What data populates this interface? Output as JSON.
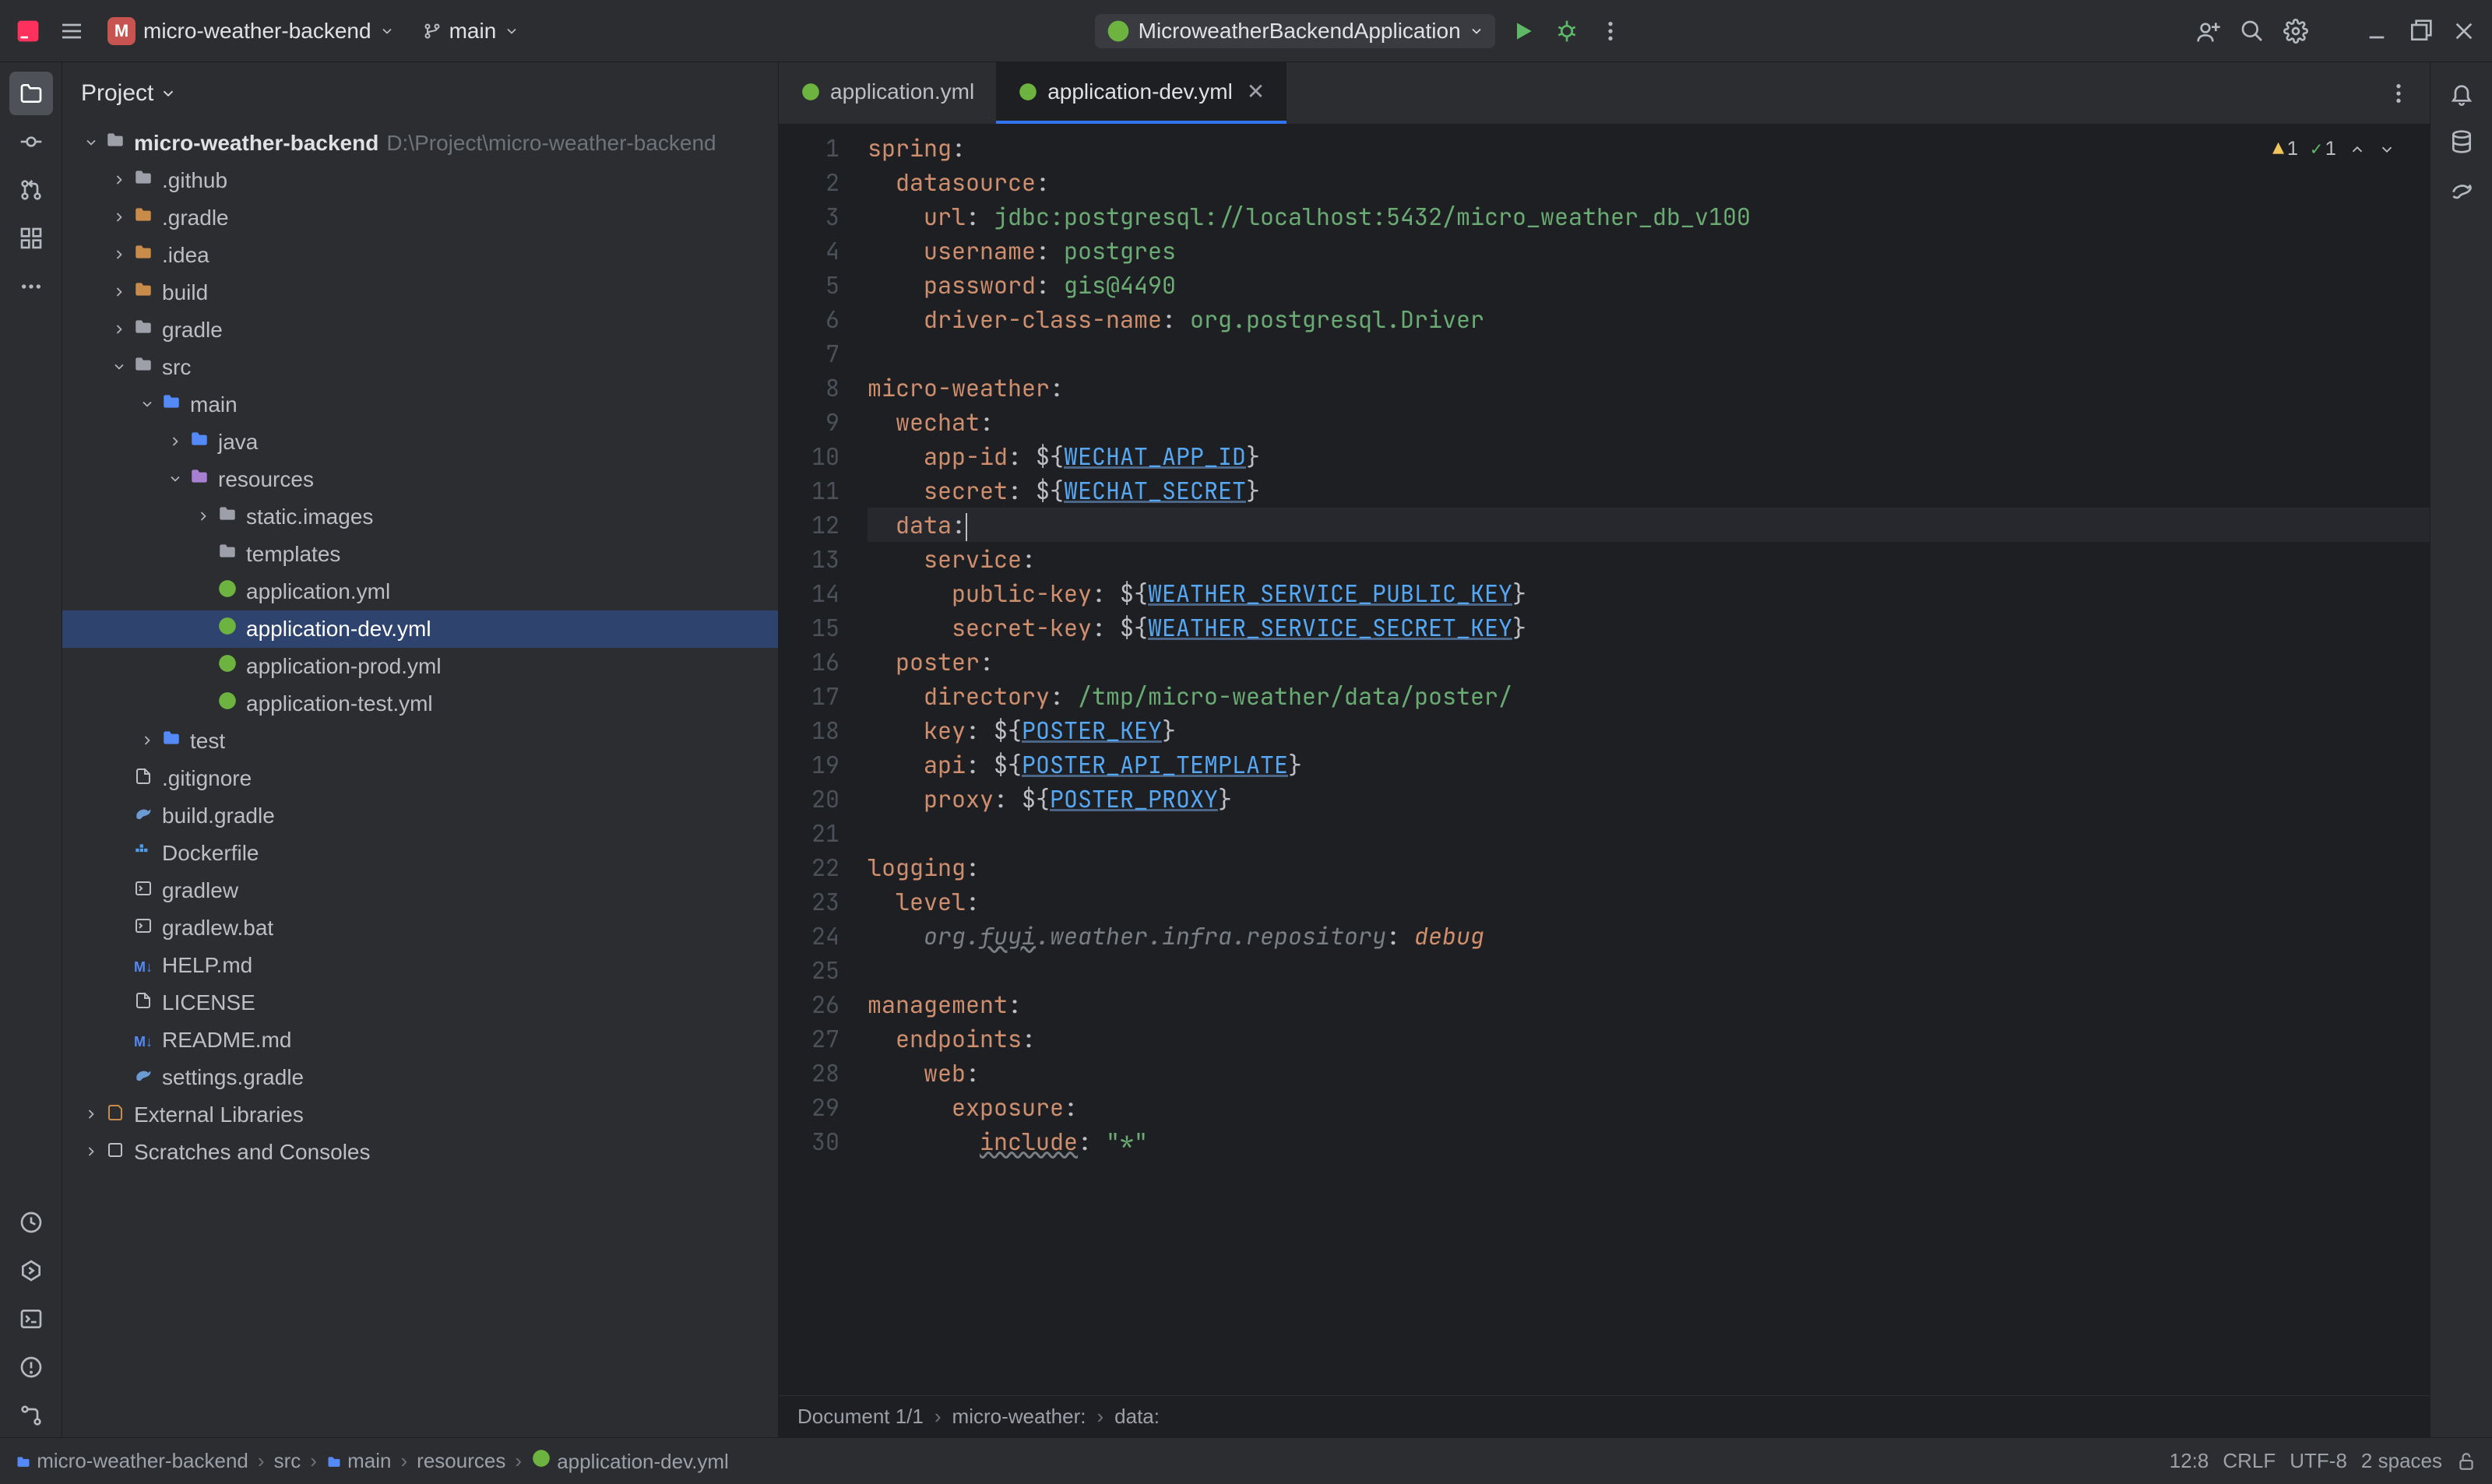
{
  "navbar": {
    "projectInitial": "M",
    "projectName": "micro-weather-backend",
    "branch": "main",
    "runConfig": "MicroweatherBackendApplication"
  },
  "projectPane": {
    "title": "Project",
    "rootName": "micro-weather-backend",
    "rootPath": "D:\\Project\\micro-weather-backend",
    "items": [
      {
        "depth": 1,
        "chev": "closed",
        "icon": "folder",
        "label": ".github"
      },
      {
        "depth": 1,
        "chev": "closed",
        "icon": "folder-orange",
        "label": ".gradle"
      },
      {
        "depth": 1,
        "chev": "closed",
        "icon": "folder-orange",
        "label": ".idea"
      },
      {
        "depth": 1,
        "chev": "closed",
        "icon": "folder-orange",
        "label": "build"
      },
      {
        "depth": 1,
        "chev": "closed",
        "icon": "folder",
        "label": "gradle"
      },
      {
        "depth": 1,
        "chev": "open",
        "icon": "folder",
        "label": "src"
      },
      {
        "depth": 2,
        "chev": "open",
        "icon": "folder-blue",
        "label": "main"
      },
      {
        "depth": 3,
        "chev": "closed",
        "icon": "folder-blue",
        "label": "java"
      },
      {
        "depth": 3,
        "chev": "open",
        "icon": "folder-res",
        "label": "resources"
      },
      {
        "depth": 4,
        "chev": "closed",
        "icon": "folder",
        "label": "static.images"
      },
      {
        "depth": 4,
        "chev": "none",
        "icon": "folder",
        "label": "templates"
      },
      {
        "depth": 4,
        "chev": "none",
        "icon": "spring",
        "label": "application.yml"
      },
      {
        "depth": 4,
        "chev": "none",
        "icon": "spring",
        "label": "application-dev.yml",
        "selected": true
      },
      {
        "depth": 4,
        "chev": "none",
        "icon": "spring",
        "label": "application-prod.yml"
      },
      {
        "depth": 4,
        "chev": "none",
        "icon": "spring",
        "label": "application-test.yml"
      },
      {
        "depth": 2,
        "chev": "closed",
        "icon": "folder-blue",
        "label": "test"
      },
      {
        "depth": 1,
        "chev": "none",
        "icon": "file",
        "label": ".gitignore"
      },
      {
        "depth": 1,
        "chev": "none",
        "icon": "gradle",
        "label": "build.gradle"
      },
      {
        "depth": 1,
        "chev": "none",
        "icon": "docker",
        "label": "Dockerfile"
      },
      {
        "depth": 1,
        "chev": "none",
        "icon": "sh",
        "label": "gradlew"
      },
      {
        "depth": 1,
        "chev": "none",
        "icon": "sh",
        "label": "gradlew.bat"
      },
      {
        "depth": 1,
        "chev": "none",
        "icon": "md",
        "label": "HELP.md",
        "class": "c-md"
      },
      {
        "depth": 1,
        "chev": "none",
        "icon": "file",
        "label": "LICENSE"
      },
      {
        "depth": 1,
        "chev": "none",
        "icon": "md",
        "label": "README.md"
      },
      {
        "depth": 1,
        "chev": "none",
        "icon": "gradle",
        "label": "settings.gradle"
      }
    ],
    "extLibs": "External Libraries",
    "scratches": "Scratches and Consoles"
  },
  "tabs": [
    {
      "label": "application.yml",
      "active": false
    },
    {
      "label": "application-dev.yml",
      "active": true
    }
  ],
  "inspections": {
    "warn": "1",
    "ok": "1"
  },
  "code": {
    "lines": [
      [
        [
          "k-key",
          "spring"
        ],
        [
          "k-plain",
          ":"
        ]
      ],
      [
        [
          "k-plain",
          "  "
        ],
        [
          "k-key",
          "datasource"
        ],
        [
          "k-plain",
          ":"
        ]
      ],
      [
        [
          "k-plain",
          "    "
        ],
        [
          "k-key",
          "url"
        ],
        [
          "k-plain",
          ": "
        ],
        [
          "k-str",
          "jdbc:postgresql://localhost:5432/micro_weather_db_v100"
        ]
      ],
      [
        [
          "k-plain",
          "    "
        ],
        [
          "k-key",
          "username"
        ],
        [
          "k-plain",
          ": "
        ],
        [
          "k-str",
          "postgres"
        ]
      ],
      [
        [
          "k-plain",
          "    "
        ],
        [
          "k-key",
          "password"
        ],
        [
          "k-plain",
          ": "
        ],
        [
          "k-str",
          "gis@4490"
        ]
      ],
      [
        [
          "k-plain",
          "    "
        ],
        [
          "k-key",
          "driver-class-name"
        ],
        [
          "k-plain",
          ": "
        ],
        [
          "k-str",
          "org.postgresql.Driver"
        ]
      ],
      [],
      [
        [
          "k-key",
          "micro-weather"
        ],
        [
          "k-plain",
          ":"
        ]
      ],
      [
        [
          "k-plain",
          "  "
        ],
        [
          "k-key",
          "wechat"
        ],
        [
          "k-plain",
          ":"
        ]
      ],
      [
        [
          "k-plain",
          "    "
        ],
        [
          "k-key",
          "app-id"
        ],
        [
          "k-plain",
          ": ${"
        ],
        [
          "k-var",
          "WECHAT_APP_ID"
        ],
        [
          "k-plain",
          "}"
        ]
      ],
      [
        [
          "k-plain",
          "    "
        ],
        [
          "k-key",
          "secret"
        ],
        [
          "k-plain",
          ": ${"
        ],
        [
          "k-var",
          "WECHAT_SECRET"
        ],
        [
          "k-plain",
          "}"
        ]
      ],
      [
        [
          "k-plain",
          "  "
        ],
        [
          "k-key",
          "data"
        ],
        [
          "k-plain",
          ":"
        ],
        [
          "caret",
          ""
        ]
      ],
      [
        [
          "k-plain",
          "    "
        ],
        [
          "k-key",
          "service"
        ],
        [
          "k-plain",
          ":"
        ]
      ],
      [
        [
          "k-plain",
          "      "
        ],
        [
          "k-key",
          "public-key"
        ],
        [
          "k-plain",
          ": ${"
        ],
        [
          "k-var",
          "WEATHER_SERVICE_PUBLIC_KEY"
        ],
        [
          "k-plain",
          "}"
        ]
      ],
      [
        [
          "k-plain",
          "      "
        ],
        [
          "k-key",
          "secret-key"
        ],
        [
          "k-plain",
          ": ${"
        ],
        [
          "k-var",
          "WEATHER_SERVICE_SECRET_KEY"
        ],
        [
          "k-plain",
          "}"
        ]
      ],
      [
        [
          "k-plain",
          "  "
        ],
        [
          "k-key",
          "poster"
        ],
        [
          "k-plain",
          ":"
        ]
      ],
      [
        [
          "k-plain",
          "    "
        ],
        [
          "k-key",
          "directory"
        ],
        [
          "k-plain",
          ": "
        ],
        [
          "k-str",
          "/tmp/micro-weather/data/poster/"
        ]
      ],
      [
        [
          "k-plain",
          "    "
        ],
        [
          "k-key",
          "key"
        ],
        [
          "k-plain",
          ": ${"
        ],
        [
          "k-var",
          "POSTER_KEY"
        ],
        [
          "k-plain",
          "}"
        ]
      ],
      [
        [
          "k-plain",
          "    "
        ],
        [
          "k-key",
          "api"
        ],
        [
          "k-plain",
          ": ${"
        ],
        [
          "k-var",
          "POSTER_API_TEMPLATE"
        ],
        [
          "k-plain",
          "}"
        ]
      ],
      [
        [
          "k-plain",
          "    "
        ],
        [
          "k-key",
          "proxy"
        ],
        [
          "k-plain",
          ": ${"
        ],
        [
          "k-var",
          "POSTER_PROXY"
        ],
        [
          "k-plain",
          "}"
        ]
      ],
      [],
      [
        [
          "k-key",
          "logging"
        ],
        [
          "k-plain",
          ":"
        ]
      ],
      [
        [
          "k-plain",
          "  "
        ],
        [
          "k-key",
          "level"
        ],
        [
          "k-plain",
          ":"
        ]
      ],
      [
        [
          "k-plain",
          "    "
        ],
        [
          "k-cmt",
          "org."
        ],
        [
          "k-under k-cmt",
          "fuyi"
        ],
        [
          "k-cmt",
          ".weather.infra.repository"
        ],
        [
          "k-plain",
          ": "
        ],
        [
          "k-kw",
          "debug"
        ]
      ],
      [],
      [
        [
          "k-key",
          "management"
        ],
        [
          "k-plain",
          ":"
        ]
      ],
      [
        [
          "k-plain",
          "  "
        ],
        [
          "k-key",
          "endpoints"
        ],
        [
          "k-plain",
          ":"
        ]
      ],
      [
        [
          "k-plain",
          "    "
        ],
        [
          "k-key",
          "web"
        ],
        [
          "k-plain",
          ":"
        ]
      ],
      [
        [
          "k-plain",
          "      "
        ],
        [
          "k-key",
          "exposure"
        ],
        [
          "k-plain",
          ":"
        ]
      ],
      [
        [
          "k-plain",
          "        "
        ],
        [
          "k-under k-key",
          "include"
        ],
        [
          "k-plain",
          ": "
        ],
        [
          "k-str",
          "\"*\""
        ]
      ]
    ],
    "currentLine": 12
  },
  "editorBreadcrumb": {
    "doc": "Document 1/1",
    "p1": "micro-weather:",
    "p2": "data:"
  },
  "statusBar": {
    "path": [
      "micro-weather-backend",
      "src",
      "main",
      "resources",
      "application-dev.yml"
    ],
    "pos": "12:8",
    "sep": "CRLF",
    "enc": "UTF-8",
    "indent": "2 spaces"
  }
}
